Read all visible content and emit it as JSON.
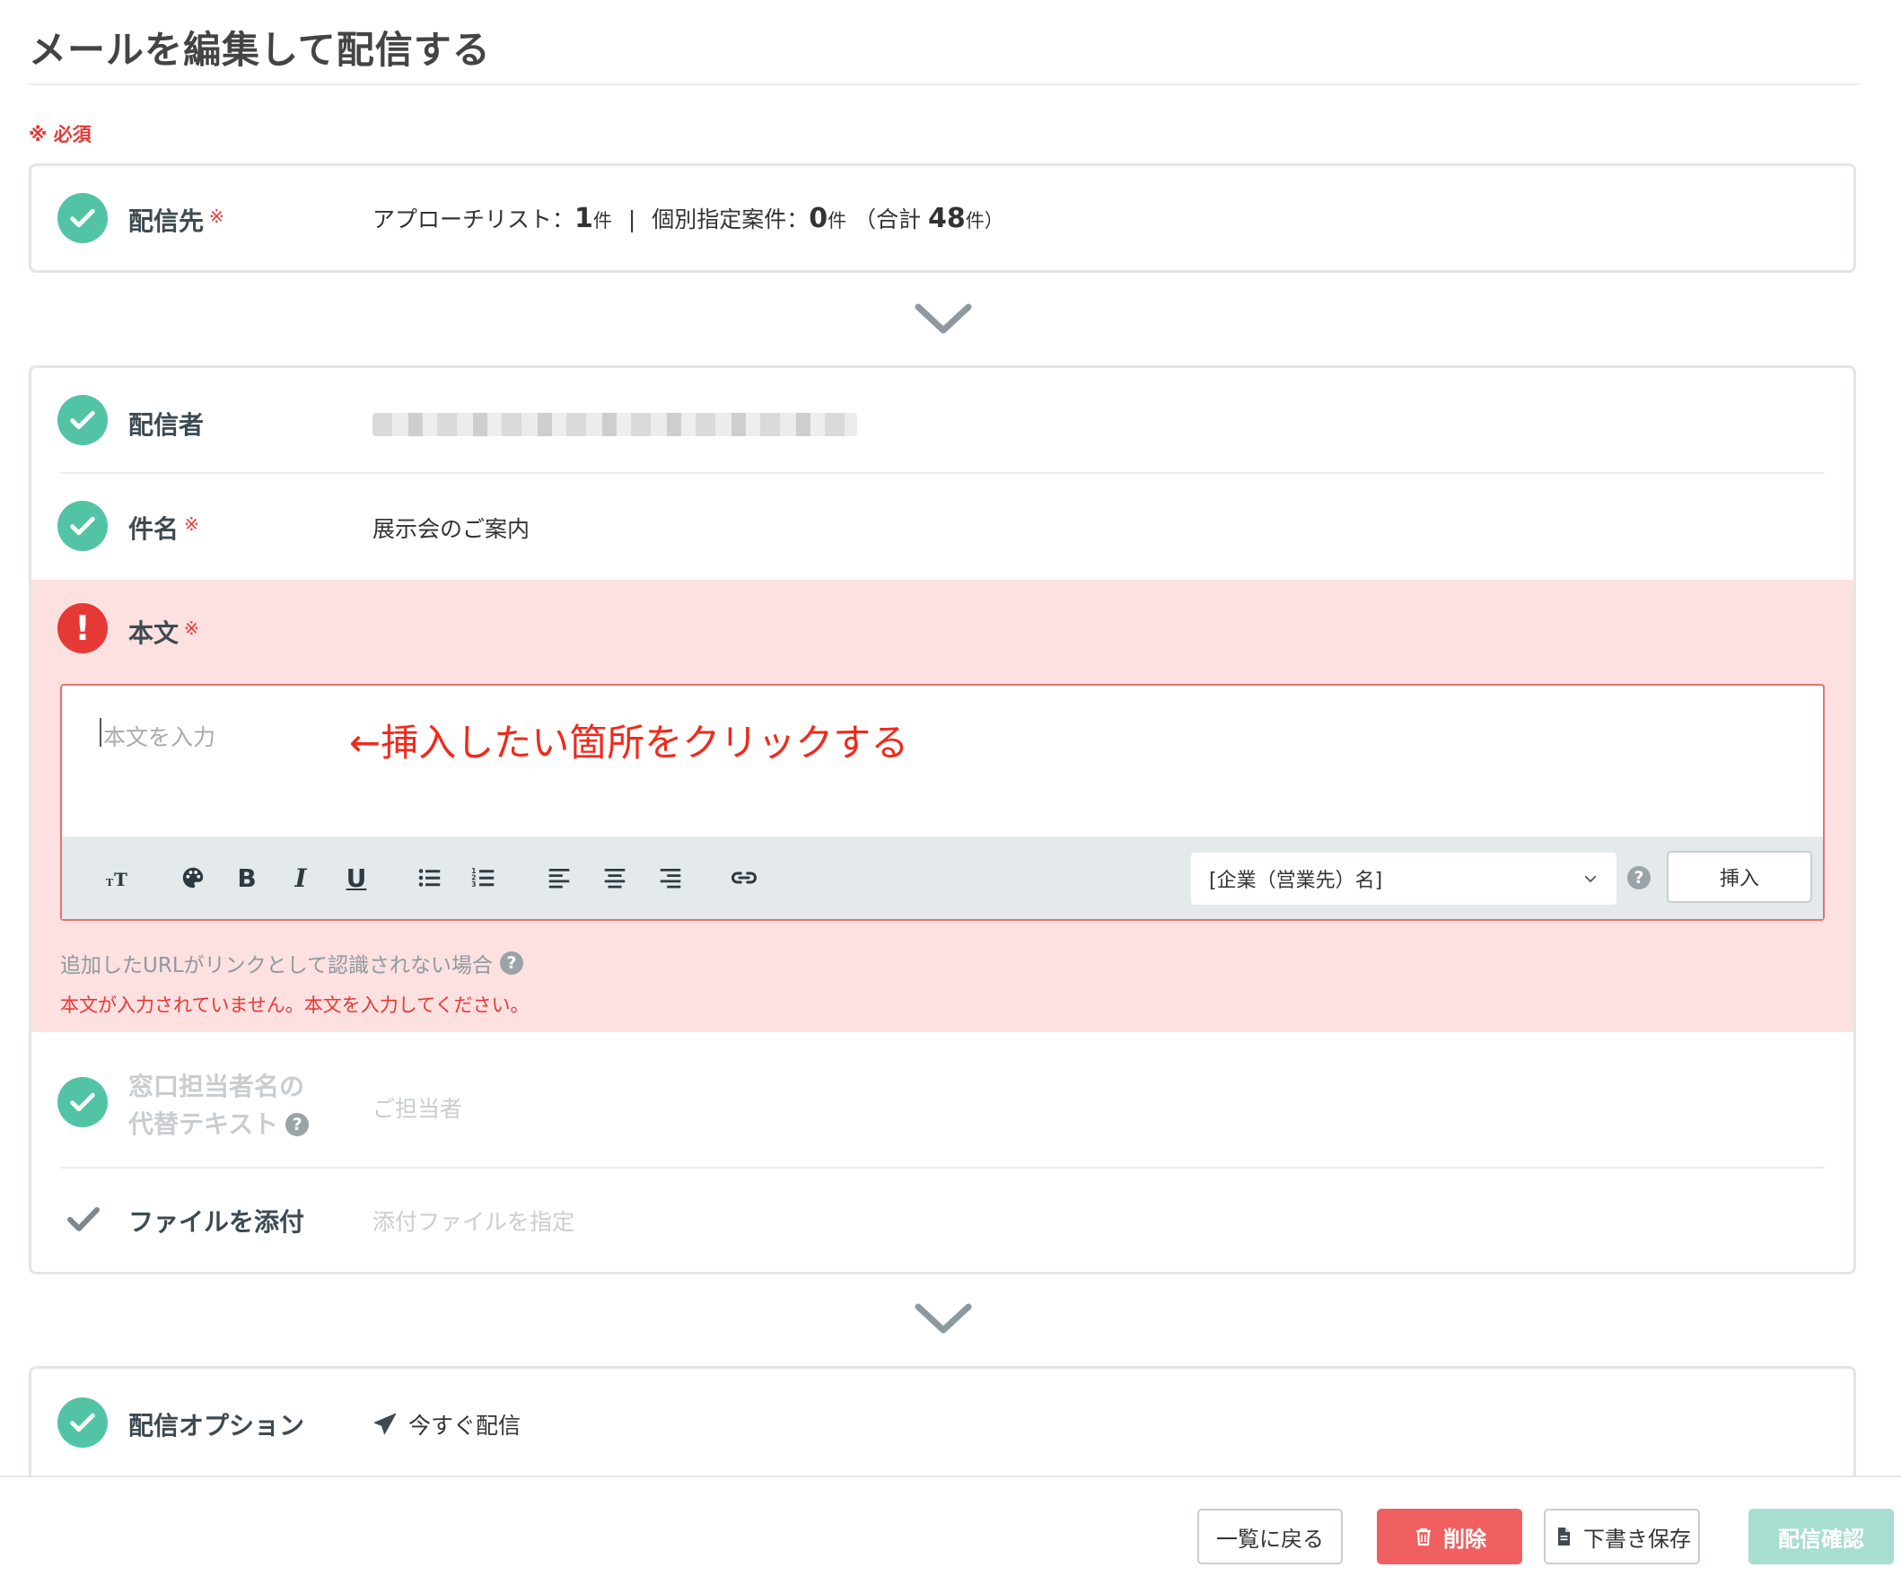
{
  "page": {
    "title": "メールを編集して配信する",
    "required_note": "※ 必須",
    "required_mark": "※"
  },
  "recipients": {
    "label": "配信先",
    "list_label": "アプローチリスト：",
    "list_count": "1",
    "unit": "件",
    "separator": "|",
    "individual_label": "個別指定案件：",
    "individual_count": "0",
    "total_prefix": "（合計",
    "total_count": "48",
    "total_suffix": "件）"
  },
  "sender": {
    "label": "配信者"
  },
  "subject": {
    "label": "件名",
    "value": "展示会のご案内"
  },
  "body": {
    "label": "本文",
    "placeholder": "本文を入力",
    "annotation": "←挿入したい箇所をクリックする",
    "toolbar": {
      "items": [
        "text-size-icon",
        "palette-icon",
        "bold-icon",
        "italic-icon",
        "underline-icon",
        "bullet-list-icon",
        "numbered-list-icon",
        "align-left-icon",
        "align-center-icon",
        "align-right-icon",
        "link-icon"
      ],
      "bold": "B",
      "italic": "I",
      "underline": "U"
    },
    "merge_field_select": "[企業（営業先）名]",
    "insert_button": "挿入",
    "url_note": "追加したURLがリンクとして認識されない場合",
    "error_message": "本文が入力されていません。本文を入力してください。"
  },
  "contact_alt": {
    "label_line1": "窓口担当者名の",
    "label_line2": "代替テキスト",
    "value": "ご担当者"
  },
  "attachment": {
    "label": "ファイルを添付",
    "value": "添付ファイルを指定"
  },
  "options": {
    "label": "配信オプション",
    "value": "今すぐ配信"
  },
  "footer": {
    "back_button": "一覧に戻る",
    "delete_button": "削除",
    "draft_button": "下書き保存",
    "confirm_button": "配信確認"
  },
  "colors": {
    "check_green": "#52c4a5",
    "error_red": "#e53935",
    "error_bg": "#fde0e0",
    "delete_btn": "#f06060",
    "confirm_btn_disabled": "#a8ddd1"
  }
}
